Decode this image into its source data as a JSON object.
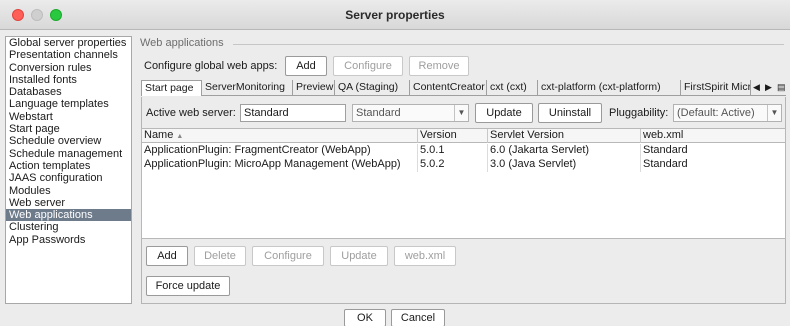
{
  "window": {
    "title": "Server properties"
  },
  "sidebar": {
    "items": [
      {
        "label": "Global server properties",
        "selected": false
      },
      {
        "label": "Presentation channels",
        "selected": false
      },
      {
        "label": "Conversion rules",
        "selected": false
      },
      {
        "label": "Installed fonts",
        "selected": false
      },
      {
        "label": "Databases",
        "selected": false
      },
      {
        "label": "Language templates",
        "selected": false
      },
      {
        "label": "Webstart",
        "selected": false
      },
      {
        "label": "Start page",
        "selected": false
      },
      {
        "label": "Schedule overview",
        "selected": false
      },
      {
        "label": "Schedule management",
        "selected": false
      },
      {
        "label": "Action templates",
        "selected": false
      },
      {
        "label": "JAAS configuration",
        "selected": false
      },
      {
        "label": "Modules",
        "selected": false
      },
      {
        "label": "Web server",
        "selected": false
      },
      {
        "label": "Web applications",
        "selected": true
      },
      {
        "label": "Clustering",
        "selected": false
      },
      {
        "label": "App Passwords",
        "selected": false
      }
    ]
  },
  "content": {
    "group_title": "Web applications",
    "configure_label": "Configure global web apps:",
    "add_label": "Add",
    "configure_button": "Configure",
    "remove_button": "Remove"
  },
  "tabs": [
    {
      "label": "Start page",
      "active": true
    },
    {
      "label": "ServerMonitoring",
      "active": false
    },
    {
      "label": "Preview",
      "active": false
    },
    {
      "label": "QA (Staging)",
      "active": false
    },
    {
      "label": "ContentCreator",
      "active": false
    },
    {
      "label": "cxt (cxt)",
      "active": false
    },
    {
      "label": "cxt-platform (cxt-platform)",
      "active": false
    },
    {
      "label": "FirstSpirit MicroApp",
      "active": false
    }
  ],
  "tab_nav": {
    "left": "◀",
    "right": "▶",
    "list": "▤"
  },
  "webserver": {
    "active_label": "Active web server:",
    "active_value": "Standard",
    "combo_value": "Standard",
    "update_button": "Update",
    "uninstall_button": "Uninstall",
    "pluggability_label": "Pluggability:",
    "pluggability_value": "(Default: Active)"
  },
  "table": {
    "columns": [
      "Name",
      "Version",
      "Servlet Version",
      "web.xml"
    ],
    "rows": [
      [
        "ApplicationPlugin: FragmentCreator (WebApp)",
        "5.0.1",
        "6.0 (Jakarta Servlet)",
        "Standard"
      ],
      [
        "ApplicationPlugin: MicroApp Management (WebApp)",
        "5.0.2",
        "3.0 (Java Servlet)",
        "Standard"
      ]
    ]
  },
  "table_buttons": {
    "add": "Add",
    "delete": "Delete",
    "configure": "Configure",
    "update": "Update",
    "webxml": "web.xml"
  },
  "force_update": "Force update",
  "dialog": {
    "ok": "OK",
    "cancel": "Cancel"
  },
  "colors": {
    "selected_bg": "#6e7b8b",
    "close": "#ff5f57",
    "zoom": "#28c840"
  }
}
